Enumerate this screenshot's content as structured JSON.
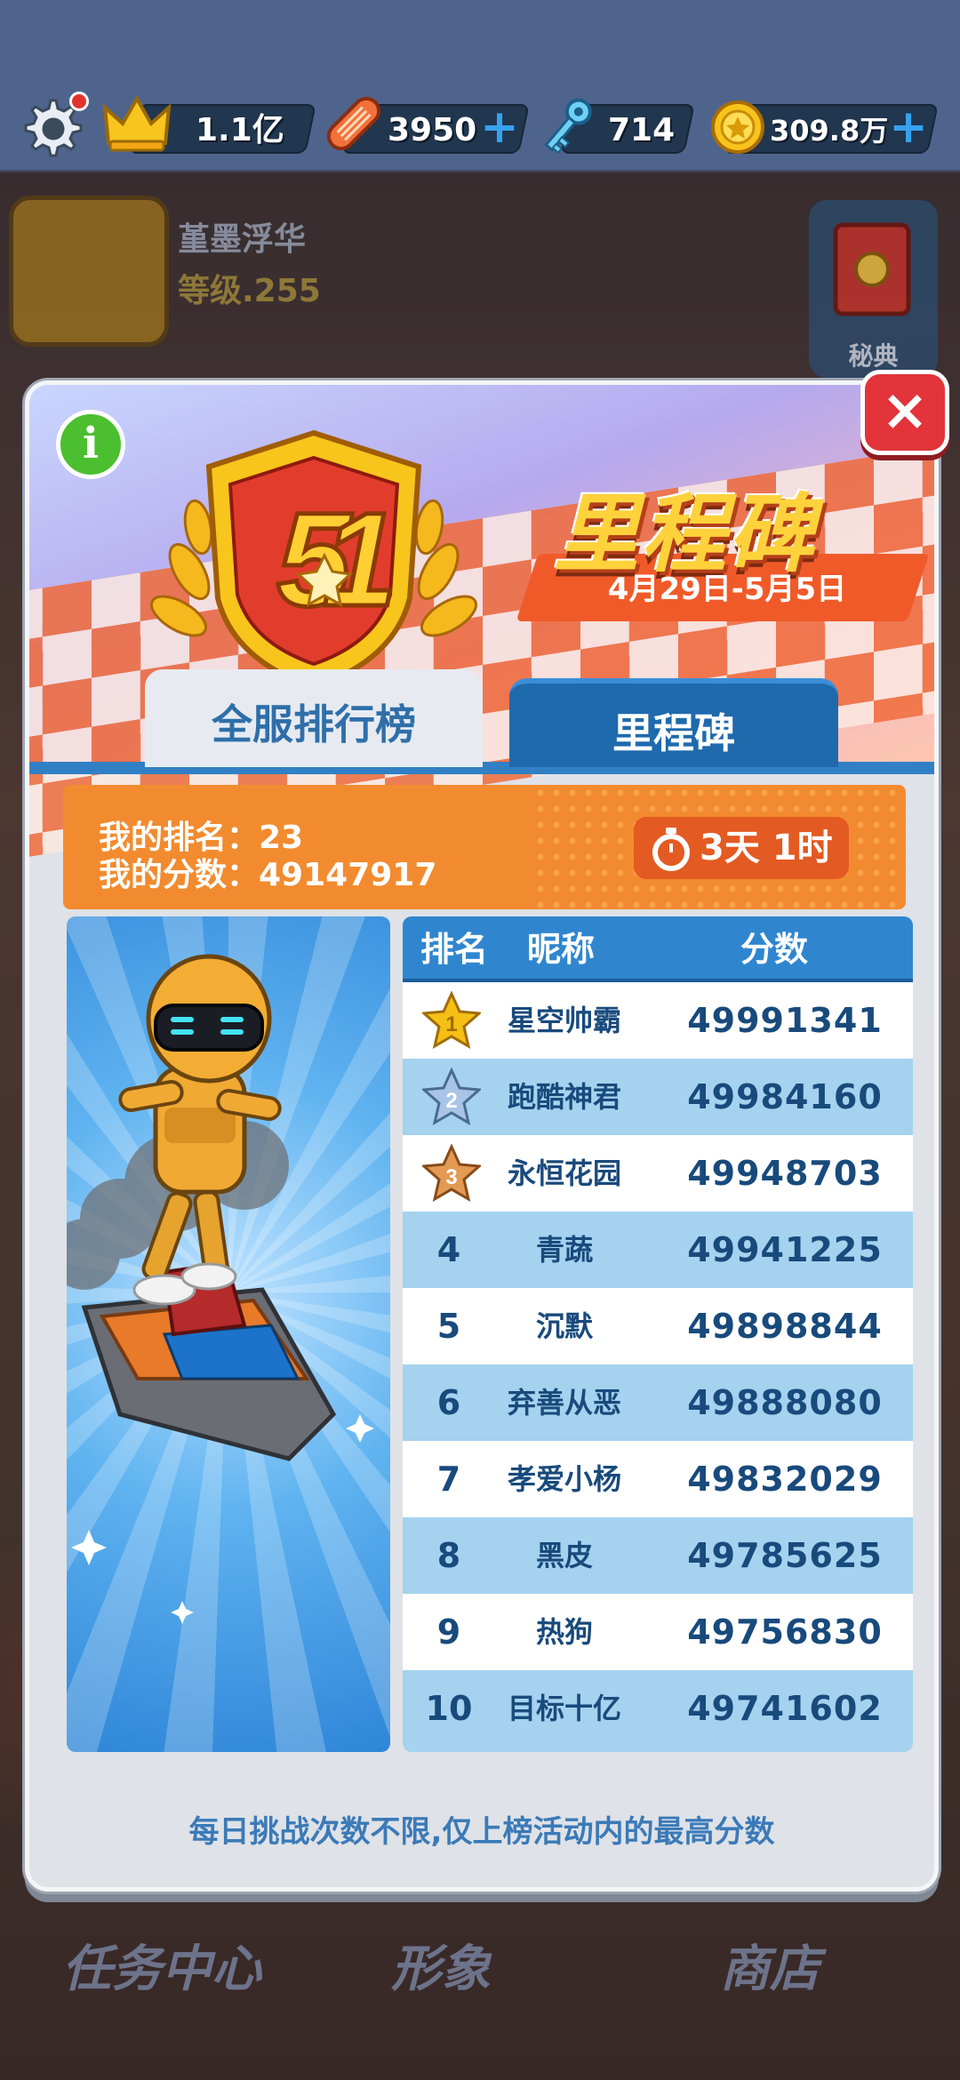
{
  "topbar": {
    "crown_value": "1.1亿",
    "board_value": "3950",
    "key_value": "714",
    "coin_value": "309.8万",
    "plus_label": "+",
    "accent_plus": "#35a2f0"
  },
  "profile": {
    "name": "堇墨浮华",
    "level": "等级.255",
    "guide_label": "秘典"
  },
  "banner": {
    "title": "里程碑",
    "date_range": "4月29日-5月5日",
    "info_label": "i",
    "close_label": "×"
  },
  "tabs": [
    {
      "label": "全服排行榜",
      "active": false
    },
    {
      "label": "里程碑",
      "active": true
    }
  ],
  "my": {
    "rank_text": "我的排名：23",
    "score_text": "我的分数：49147917",
    "timer_text": "3天 1时"
  },
  "leaderboard": {
    "headers": {
      "rank": "排名",
      "nickname": "昵称",
      "score": "分数"
    },
    "rows": [
      {
        "rank": "1",
        "name": "星空帅霸",
        "score": "49991341",
        "medal": "gold-star-icon"
      },
      {
        "rank": "2",
        "name": "跑酷神君",
        "score": "49984160",
        "medal": "silver-star-icon"
      },
      {
        "rank": "3",
        "name": "永恒花园",
        "score": "49948703",
        "medal": "bronze-star-icon"
      },
      {
        "rank": "4",
        "name": "青蔬",
        "score": "49941225"
      },
      {
        "rank": "5",
        "name": "沉默",
        "score": "49898844"
      },
      {
        "rank": "6",
        "name": "弃善从恶",
        "score": "49888080"
      },
      {
        "rank": "7",
        "name": "孝爱小杨",
        "score": "49832029"
      },
      {
        "rank": "8",
        "name": "黑皮",
        "score": "49785625"
      },
      {
        "rank": "9",
        "name": "热狗",
        "score": "49756830"
      },
      {
        "rank": "10",
        "name": "目标十亿",
        "score": "49741602"
      }
    ]
  },
  "footer_note": "每日挑战次数不限,仅上榜活动内的最高分数",
  "bottom_nav": [
    "任务中心",
    "形象",
    "商店"
  ],
  "colors": {
    "panel_bg": "#dfe2e7",
    "tab_active": "#1f6aac",
    "strip_orange": "#f28b2f",
    "row_blue": "#a5d2ef",
    "text_dark_blue": "#184a7c",
    "gold": "#f5c016",
    "silver": "#a9c4e6",
    "bronze": "#e39a55"
  }
}
